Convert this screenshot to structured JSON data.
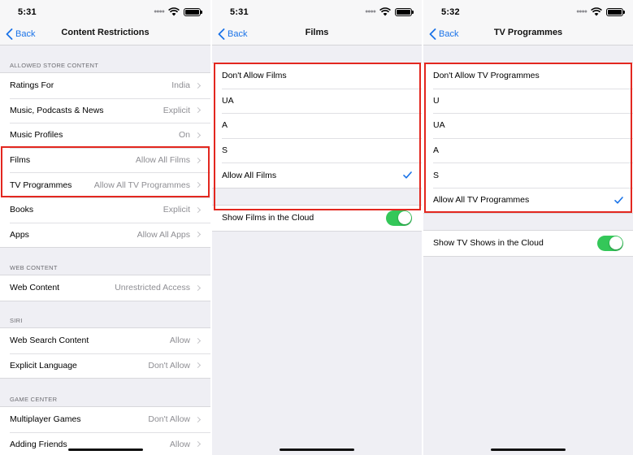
{
  "panels": [
    {
      "time": "5:31",
      "back_label": "Back",
      "title": "Content Restrictions",
      "sections": {
        "store": {
          "header": "ALLOWED STORE CONTENT",
          "rows": [
            {
              "label": "Ratings For",
              "value": "India"
            },
            {
              "label": "Music, Podcasts & News",
              "value": "Explicit"
            },
            {
              "label": "Music Profiles",
              "value": "On"
            },
            {
              "label": "Films",
              "value": "Allow All Films"
            },
            {
              "label": "TV Programmes",
              "value": "Allow All TV Programmes"
            },
            {
              "label": "Books",
              "value": "Explicit"
            },
            {
              "label": "Apps",
              "value": "Allow All Apps"
            }
          ]
        },
        "web": {
          "header": "WEB CONTENT",
          "rows": [
            {
              "label": "Web Content",
              "value": "Unrestricted Access"
            }
          ]
        },
        "siri": {
          "header": "SIRI",
          "rows": [
            {
              "label": "Web Search Content",
              "value": "Allow"
            },
            {
              "label": "Explicit Language",
              "value": "Don't Allow"
            }
          ]
        },
        "game": {
          "header": "GAME CENTER",
          "rows": [
            {
              "label": "Multiplayer Games",
              "value": "Don't Allow"
            },
            {
              "label": "Adding Friends",
              "value": "Allow"
            }
          ]
        }
      }
    },
    {
      "time": "5:31",
      "back_label": "Back",
      "title": "Films",
      "options": [
        "Don't Allow Films",
        "UA",
        "A",
        "S",
        "Allow All Films"
      ],
      "selected_option": "Allow All Films",
      "toggle": {
        "label": "Show Films in the Cloud",
        "on": true
      }
    },
    {
      "time": "5:32",
      "back_label": "Back",
      "title": "TV Programmes",
      "options": [
        "Don't Allow TV Programmes",
        "U",
        "UA",
        "A",
        "S",
        "Allow All TV Programmes"
      ],
      "selected_option": "Allow All TV Programmes",
      "toggle": {
        "label": "Show TV Shows in the Cloud",
        "on": true
      }
    }
  ],
  "colors": {
    "accent": "#1a73e8",
    "highlight": "#e3271f",
    "toggle_on": "#34c759",
    "background": "#efeff4"
  },
  "icons": [
    "back-chevron-icon",
    "chevron-right-icon",
    "checkmark-icon",
    "wifi-icon",
    "battery-icon",
    "signal-dots-icon"
  ]
}
